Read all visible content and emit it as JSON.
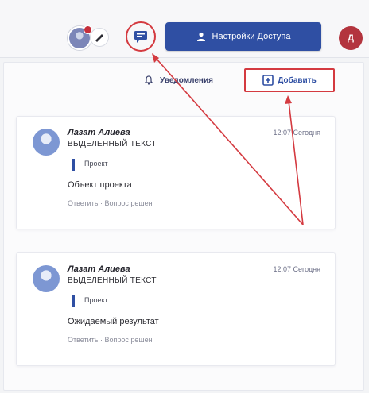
{
  "topbar": {
    "access_button_label": "Настройки Доступа",
    "account_initial": "Д"
  },
  "panel": {
    "notifications_label": "Уведомления",
    "add_button_label": "Добавить"
  },
  "comments": [
    {
      "author": "Лазат Алиева",
      "time": "12:07 Сегодня",
      "selected_text": "ВЫДЕЛЕННЫЙ ТЕКСТ",
      "quote": "Проект",
      "body": "Объект проекта",
      "meta": "Ответить · Вопрос решен"
    },
    {
      "author": "Лазат Алиева",
      "time": "12:07 Сегодня",
      "selected_text": "ВЫДЕЛЕННЫЙ ТЕКСТ",
      "quote": "Проект",
      "body": "Ожидаемый результат",
      "meta": "Ответить · Вопрос решен"
    }
  ],
  "colors": {
    "accent": "#2f4fa3",
    "highlight": "#d43a40"
  }
}
